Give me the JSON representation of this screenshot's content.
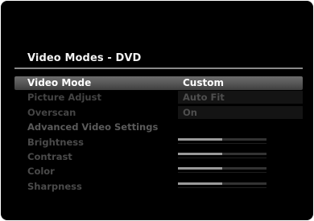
{
  "title": "Video Modes - DVD",
  "menu": {
    "video_mode": {
      "label": "Video Mode",
      "value": "Custom"
    },
    "picture_adjust": {
      "label": "Picture Adjust",
      "value": "Auto Fit"
    },
    "overscan": {
      "label": "Overscan",
      "value": "On"
    },
    "advanced": {
      "label": "Advanced Video Settings"
    },
    "brightness": {
      "label": "Brightness",
      "level": 0.5
    },
    "contrast": {
      "label": "Contrast",
      "level": 0.5
    },
    "color": {
      "label": "Color",
      "level": 0.5
    },
    "sharpness": {
      "label": "Sharpness",
      "level": 0.5
    }
  },
  "colors": {
    "background": "#000000",
    "highlight": "#5a5a5a",
    "text_active": "#ffffff",
    "text_dim": "#4a4a4a"
  }
}
